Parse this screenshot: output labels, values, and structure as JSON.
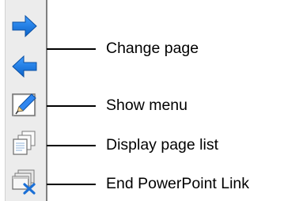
{
  "toolbar": {
    "buttons": [
      {
        "name": "next-page",
        "icon": "arrow-right-icon"
      },
      {
        "name": "previous-page",
        "icon": "arrow-left-icon"
      },
      {
        "name": "show-menu",
        "icon": "pen-icon"
      },
      {
        "name": "display-page-list",
        "icon": "page-stack-icon"
      },
      {
        "name": "end-link",
        "icon": "close-window-icon"
      }
    ]
  },
  "callouts": {
    "change_page": "Change page",
    "show_menu": "Show menu",
    "display_page_list": "Display page list",
    "end_link": "End PowerPoint Link"
  },
  "colors": {
    "arrow_blue": "#1f7fe8",
    "arrow_blue_dark": "#0d5fbf",
    "close_x": "#1a6fd6"
  }
}
